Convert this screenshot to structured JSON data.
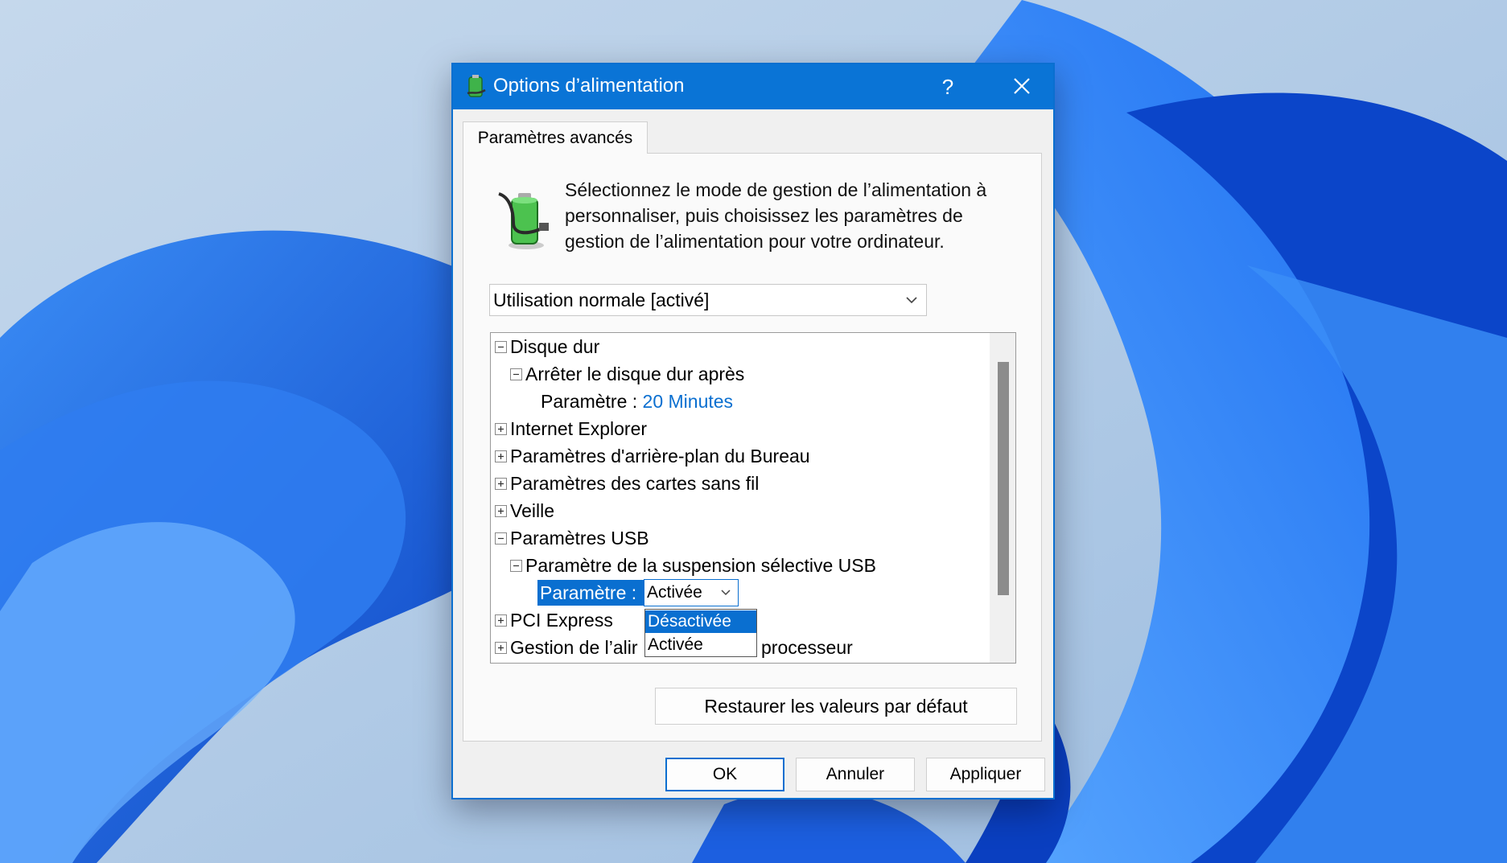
{
  "window": {
    "title": "Options d’alimentation",
    "help_label": "?",
    "close_icon": "close-icon",
    "accent_color": "#0a74d6"
  },
  "tab": {
    "label": "Paramètres avancés"
  },
  "description": [
    "Sélectionnez le mode de gestion de l’alimentation à",
    "personnaliser, puis choisissez les paramètres de",
    "gestion de l’alimentation pour votre ordinateur."
  ],
  "plan_select": {
    "value": "Utilisation normale [activé]"
  },
  "tree": {
    "items": [
      {
        "label": "Disque dur",
        "expander": "minus"
      },
      {
        "label": "Arrêter le disque dur après",
        "expander": "minus"
      },
      {
        "label": "Paramètre :",
        "value": "20 Minutes"
      },
      {
        "label": "Internet Explorer",
        "expander": "plus"
      },
      {
        "label": "Paramètres d'arrière-plan du Bureau",
        "expander": "plus"
      },
      {
        "label": "Paramètres des cartes sans fil",
        "expander": "plus"
      },
      {
        "label": "Veille",
        "expander": "plus"
      },
      {
        "label": "Paramètres USB",
        "expander": "minus"
      },
      {
        "label": "Paramètre de la suspension sélective USB",
        "expander": "minus"
      },
      {
        "label": "Paramètre :",
        "value": "Activée"
      },
      {
        "label": "PCI Express",
        "expander": "plus"
      },
      {
        "label": "Gestion de l’alir",
        "label_tail": "processeur",
        "expander": "plus"
      }
    ],
    "dropdown_options": [
      "Désactivée",
      "Activée"
    ],
    "dropdown_selected": "Désactivée"
  },
  "buttons": {
    "restore": "Restaurer les valeurs par défaut",
    "ok": "OK",
    "cancel": "Annuler",
    "apply": "Appliquer"
  }
}
